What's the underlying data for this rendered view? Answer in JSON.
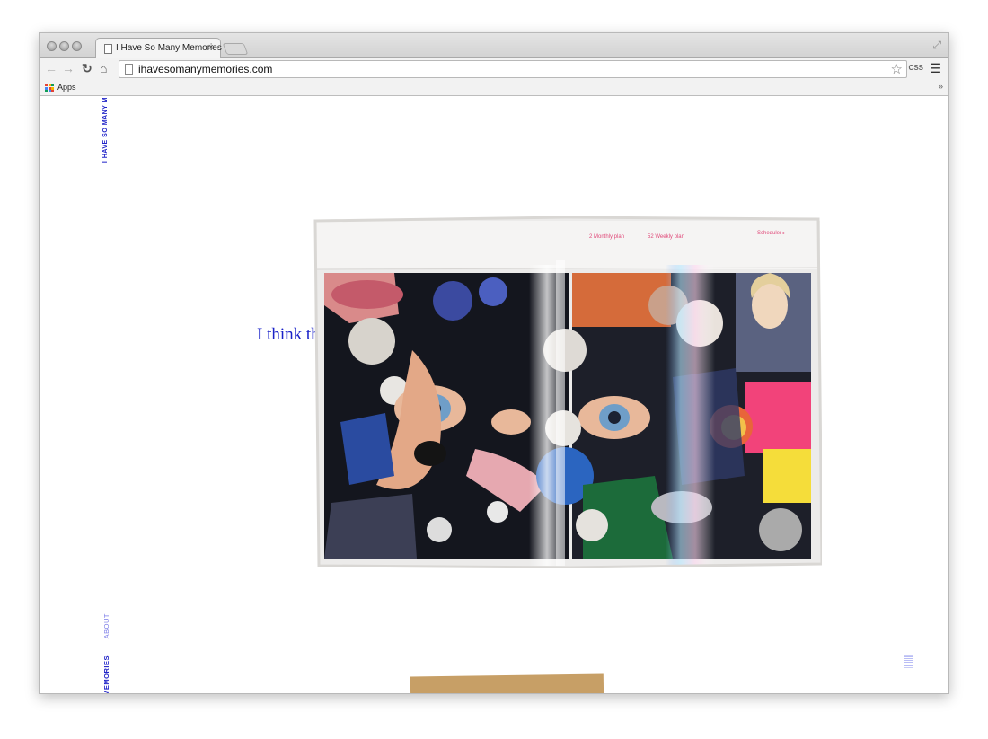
{
  "browser": {
    "tab_title": "I Have So Many Memories",
    "tab_close": "×",
    "url": "ihavesomanymemories.com",
    "extension_label": "CSS",
    "bookmarks_apps_label": "Apps",
    "bookmarks_overflow": "»",
    "icons": {
      "back": "back-arrow-icon",
      "forward": "forward-arrow-icon",
      "reload": "reload-icon",
      "home": "home-icon",
      "star": "bookmark-star-icon",
      "menu": "hamburger-menu-icon",
      "fullscreen": "fullscreen-icon"
    }
  },
  "site": {
    "title_vertical": "I HAVE SO MANY M",
    "nav": {
      "about": "ABOUT",
      "memories": "MEMORIES"
    },
    "quote_visible": "I think th",
    "colors": {
      "accent": "#2124c8",
      "nav_muted": "#7b7ce8"
    }
  },
  "artwork": {
    "tab_labels": [
      "2 Monthly plan",
      "52 Weekly plan",
      "Scheduler ▸"
    ]
  }
}
